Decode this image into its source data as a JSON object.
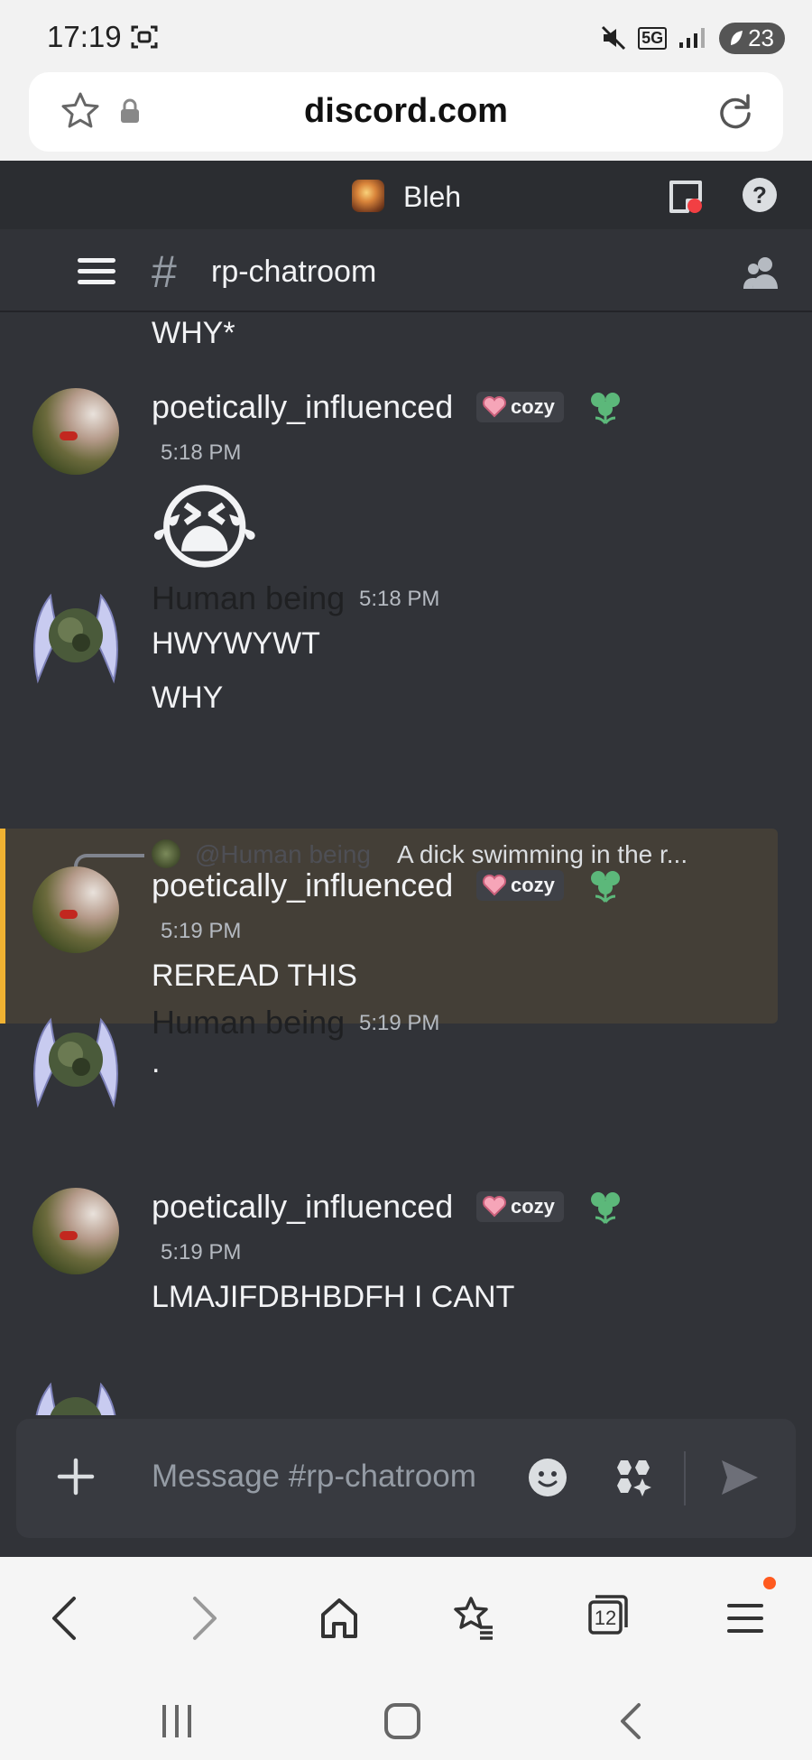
{
  "status_bar": {
    "time": "17:19",
    "network": "5G",
    "battery": "23"
  },
  "browser": {
    "url": "discord.com",
    "nav_tab_count": "12"
  },
  "server": {
    "name": "Bleh"
  },
  "channel": {
    "name": "rp-chatroom",
    "hash": "#"
  },
  "messages": [
    {
      "content": "WHY*"
    },
    {
      "username": "poetically_influenced",
      "tag": "cozy",
      "time": "5:18 PM",
      "content": "😭"
    },
    {
      "username": "Human being",
      "time": "5:18 PM",
      "lines": [
        "HWYWYWT",
        "WHY"
      ]
    },
    {
      "reply": {
        "mention": "@Human being",
        "snippet": "A dick swimming in the r..."
      },
      "username": "poetically_influenced",
      "tag": "cozy",
      "time": "5:19 PM",
      "content": "REREAD THIS"
    },
    {
      "username": "Human being",
      "time": "5:19 PM",
      "content": "."
    },
    {
      "username": "poetically_influenced",
      "tag": "cozy",
      "time": "5:19 PM",
      "content": "LMAJIFDBHBDFH I CANT"
    }
  ],
  "composer": {
    "placeholder": "Message #rp-chatroom"
  },
  "colors": {
    "background": "#313338",
    "header": "#2b2d31",
    "highlight": "#443f37",
    "highlight_bar": "#f0b232",
    "tag_green": "#5cb87a"
  }
}
